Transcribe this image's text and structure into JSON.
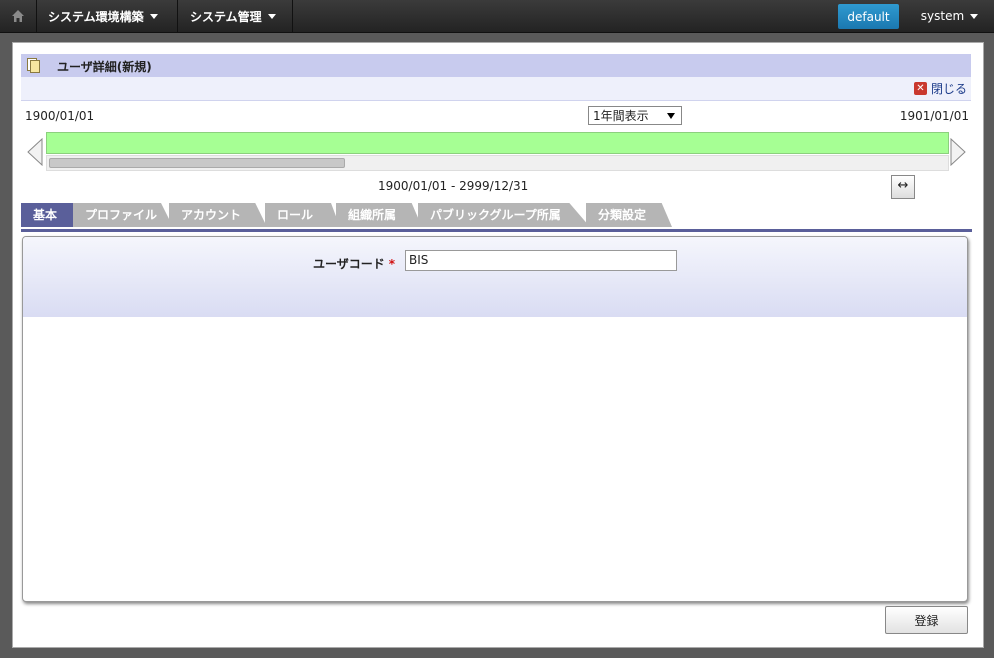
{
  "nav": {
    "menus": [
      {
        "label": "システム環境構築"
      },
      {
        "label": "システム管理"
      }
    ],
    "tenant": "default",
    "user": "system"
  },
  "page": {
    "title": "ユーザ詳細(新規)",
    "close_label": "閉じる"
  },
  "timeline": {
    "start_date": "1900/01/01",
    "end_date": "1901/01/01",
    "view_select": "1年間表示",
    "range": "1900/01/01 - 2999/12/31"
  },
  "tabs": [
    {
      "label": "基本",
      "active": true
    },
    {
      "label": "プロファイル"
    },
    {
      "label": "アカウント"
    },
    {
      "label": "ロール"
    },
    {
      "label": "組織所属"
    },
    {
      "label": "パブリックグループ所属"
    },
    {
      "label": "分類設定"
    }
  ],
  "form": {
    "user_code_label": "ユーザコード",
    "required_mark": "*",
    "user_code_value": "BIS"
  },
  "actions": {
    "register_label": "登録"
  },
  "colors": {
    "accent": "#5a5f9a",
    "timeline_bar": "#a6ff94",
    "tenant_button": "#1b78b0"
  }
}
